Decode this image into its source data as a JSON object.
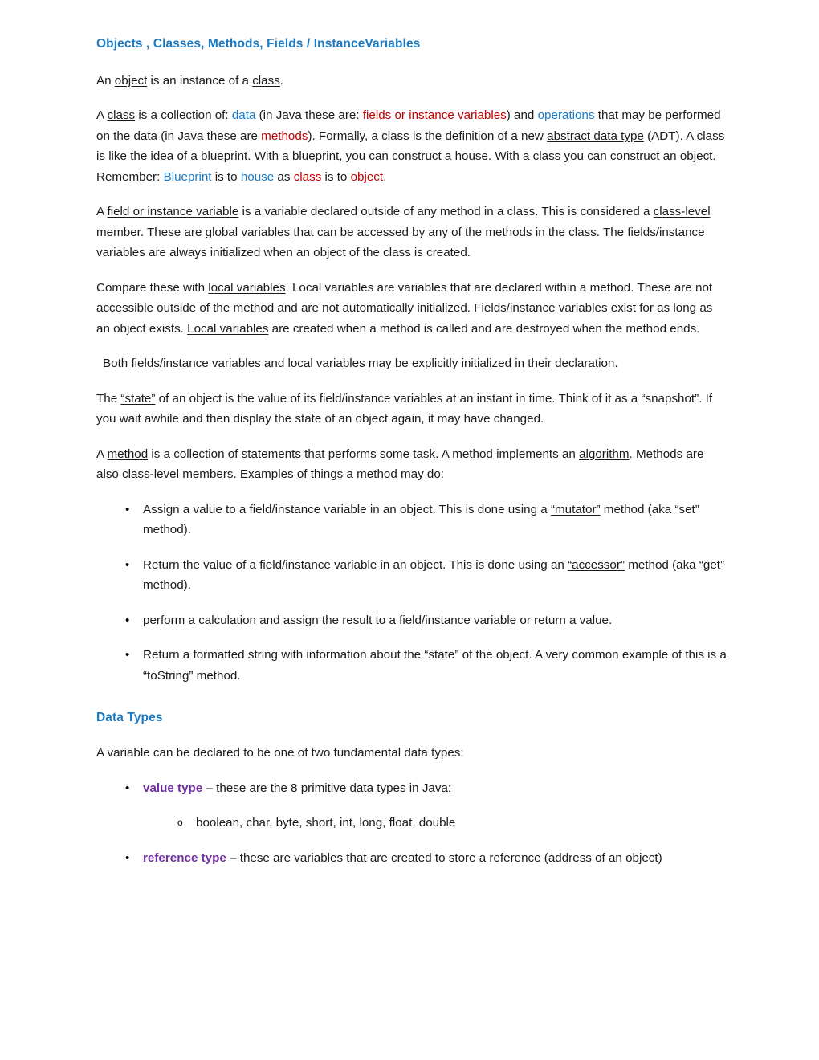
{
  "document": {
    "heading_main": "Objects , Classes,  Methods, Fields / InstanceVariables",
    "heading_data_types": "Data Types",
    "colors": {
      "heading_blue": "#1a7bc4",
      "term_blue": "#1a7bc4",
      "term_red": "#c00000",
      "term_purple": "#7030a0",
      "body_text": "#1a1a1a",
      "background": "#ffffff"
    },
    "paragraphs": {
      "p1": {
        "s1": "An ",
        "t1": "object",
        "s2": " is an instance of a ",
        "t2": "class",
        "s3": "."
      },
      "p2": {
        "s1": "A ",
        "t1": "class",
        "s2": " is a collection of: ",
        "c1": " data",
        "s3": " (in Java  these are: ",
        "c2": " fields or instance variables",
        "s4": ") and ",
        "c3": "operations",
        "s5": " that may be performed on the data (in Java  these are ",
        "c4": "methods",
        "s6": "). Formally, a class is the definition of a new ",
        "t2": "abstract data type",
        "s7": " (ADT). A class is like the idea of a blueprint. With a blueprint, you can construct a house. With a class you can construct an object. Remember: ",
        "c5": " Blueprint",
        "s8": " is to ",
        "c6": "house",
        "s9": " as ",
        "c7": "class",
        "s10": " is to ",
        "c8": "object",
        "s11": "."
      },
      "p3": {
        "s1": "A ",
        "t1": "field or instance variable",
        "s2": " is a variable declared outside of any method in a class. This is considered a ",
        "t2": "class-level",
        "s3": " member. These are ",
        "t3": "global  variables",
        "s4": " that can be accessed by any of the methods in the class. The fields/instance variables are always initialized when an object of the class is created."
      },
      "p4": {
        "s1": "Compare these with ",
        "t1": "local variables",
        "s2": ". Local variables are variables that are declared within a method. These are not accessible outside of the method and are not automatically initialized. Fields/instance variables exist for as long as an object exists. ",
        "t2": "Local variables",
        "s3": " are created when a method is called and are destroyed when the method ends."
      },
      "p5": {
        "s1": "Both fields/instance variables and local variables may be explicitly initialized in their declaration."
      },
      "p6": {
        "s1": "The ",
        "t1": "“state”",
        "s2": " of an object is the value of its field/instance variables at an instant in time. Think of it as a “snapshot”. If you wait awhile and then display the state of an object again, it may have changed."
      },
      "p7": {
        "s1": "A ",
        "t1": "method",
        "s2": " is a collection of statements that performs  some task. A method implements an ",
        "t2": "algorithm",
        "s3": ". Methods are also class-level members. Examples of things a method may do:"
      },
      "p8": {
        "s1": "A variable can be declared to be one of two fundamental data types:"
      }
    },
    "method_bullets": [
      {
        "marker": "•",
        "s1": "Assign a value to a field/instance variable in an object. This is done using a ",
        "t1": "“mutator”",
        "s2": " method (aka “set” method)."
      },
      {
        "marker": "•",
        "s1": "Return the value of a field/instance variable in an object. This is done using an ",
        "t1": "“accessor”",
        "s2": " method (aka “get” method)."
      },
      {
        "marker": "•",
        "s1": "perform a calculation and assign the result to a field/instance variable or return a value.",
        "t1": "",
        "s2": ""
      },
      {
        "marker": "•",
        "s1": "Return a formatted string with information about the “state” of the object. A very common example of this is a “toString” method.",
        "t1": "",
        "s2": ""
      }
    ],
    "data_type_bullets": {
      "value_type": {
        "marker": "•",
        "term": "value type",
        "rest": " – these are the 8 primitive data types in Java:"
      },
      "primitives": {
        "marker": "o",
        "text": "boolean, char, byte, short, int, long, float, double"
      },
      "reference_type": {
        "marker": "•",
        "term": "reference type",
        "rest": " – these are variables that are created to store a reference (address of an object)"
      }
    }
  }
}
